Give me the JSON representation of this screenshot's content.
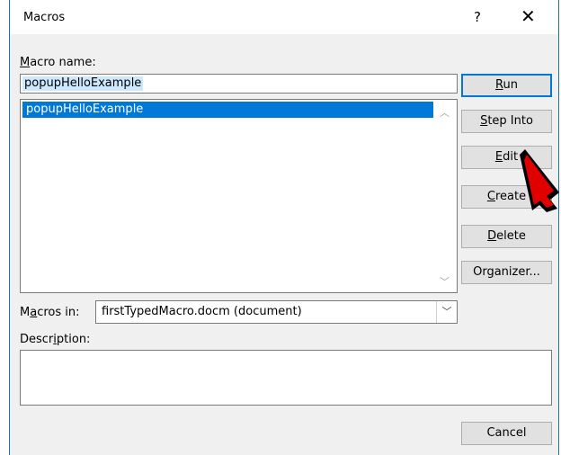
{
  "window": {
    "title": "Macros",
    "help_label": "?",
    "close_label": "✕"
  },
  "macro_name": {
    "label_accel": "M",
    "label_rest": "acro name:",
    "value": "popupHelloExample"
  },
  "macro_list": {
    "items": [
      "popupHelloExample"
    ]
  },
  "buttons": {
    "run": {
      "accel": "R",
      "rest": "un"
    },
    "step_into": {
      "accel": "S",
      "rest": "tep Into"
    },
    "edit": {
      "accel": "E",
      "rest": "dit"
    },
    "create": {
      "accel": "C",
      "rest": "reate"
    },
    "delete": {
      "accel": "D",
      "rest": "elete"
    },
    "organizer": {
      "pre": "Or",
      "accel": "g",
      "rest": "anizer..."
    },
    "cancel": {
      "label": "Cancel"
    }
  },
  "macros_in": {
    "label_pre": "M",
    "label_accel": "a",
    "label_rest": "cros in:",
    "value": "firstTypedMacro.docm (document)"
  },
  "description": {
    "label_pre": "Descr",
    "label_accel": "i",
    "label_rest": "ption:",
    "value": ""
  },
  "colors": {
    "accent": "#0078d7",
    "arrow": "#e00000"
  }
}
